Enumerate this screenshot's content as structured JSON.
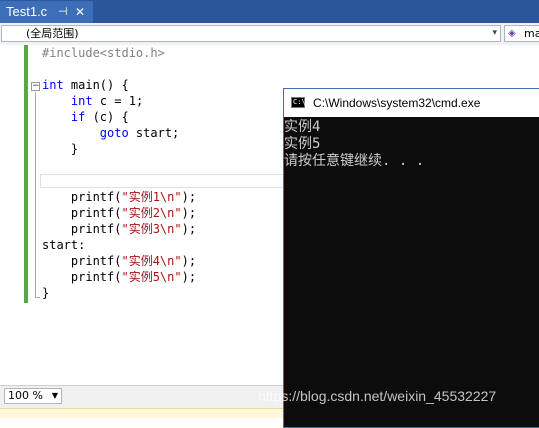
{
  "tab": {
    "filename": "Test1.c",
    "pin_glyph": "⊣",
    "close_glyph": "✕"
  },
  "navbar": {
    "scope_label": "(全局范围)",
    "member_label": "ma",
    "member_icon": "◈"
  },
  "code_lines": [
    [
      {
        "t": "#include<stdio.h>",
        "c": "pp"
      }
    ],
    [],
    [
      {
        "t": "int",
        "c": "kw"
      },
      {
        "t": " main() {",
        "c": "tx"
      }
    ],
    [
      {
        "t": "    ",
        "c": "tx"
      },
      {
        "t": "int",
        "c": "kw"
      },
      {
        "t": " c = 1;",
        "c": "tx"
      }
    ],
    [
      {
        "t": "    ",
        "c": "tx"
      },
      {
        "t": "if",
        "c": "kw"
      },
      {
        "t": " (c) {",
        "c": "tx"
      }
    ],
    [
      {
        "t": "        ",
        "c": "tx"
      },
      {
        "t": "goto",
        "c": "kw"
      },
      {
        "t": " start;",
        "c": "tx"
      }
    ],
    [
      {
        "t": "    }",
        "c": "tx"
      }
    ],
    [],
    [],
    [
      {
        "t": "    printf(",
        "c": "tx"
      },
      {
        "t": "\"实例1\\n\"",
        "c": "str"
      },
      {
        "t": ");",
        "c": "tx"
      }
    ],
    [
      {
        "t": "    printf(",
        "c": "tx"
      },
      {
        "t": "\"实例2\\n\"",
        "c": "str"
      },
      {
        "t": ");",
        "c": "tx"
      }
    ],
    [
      {
        "t": "    printf(",
        "c": "tx"
      },
      {
        "t": "\"实例3\\n\"",
        "c": "str"
      },
      {
        "t": ");",
        "c": "tx"
      }
    ],
    [
      {
        "t": "start:",
        "c": "tx"
      }
    ],
    [
      {
        "t": "    printf(",
        "c": "tx"
      },
      {
        "t": "\"实例4\\n\"",
        "c": "str"
      },
      {
        "t": ");",
        "c": "tx"
      }
    ],
    [
      {
        "t": "    printf(",
        "c": "tx"
      },
      {
        "t": "\"实例5\\n\"",
        "c": "str"
      },
      {
        "t": ");",
        "c": "tx"
      }
    ],
    [
      {
        "t": "}",
        "c": "tx"
      }
    ]
  ],
  "editor": {
    "collapse_glyph": "−"
  },
  "zoom": {
    "label": "100 %",
    "arrow": "▼"
  },
  "cmd": {
    "title": "C:\\Windows\\system32\\cmd.exe",
    "icon_text": "C:\\",
    "output": [
      "实例4",
      "实例5",
      "请按任意键继续. . ."
    ]
  },
  "watermark": "https://blog.csdn.net/weixin_45532227",
  "dropdown_arrow": "▾"
}
